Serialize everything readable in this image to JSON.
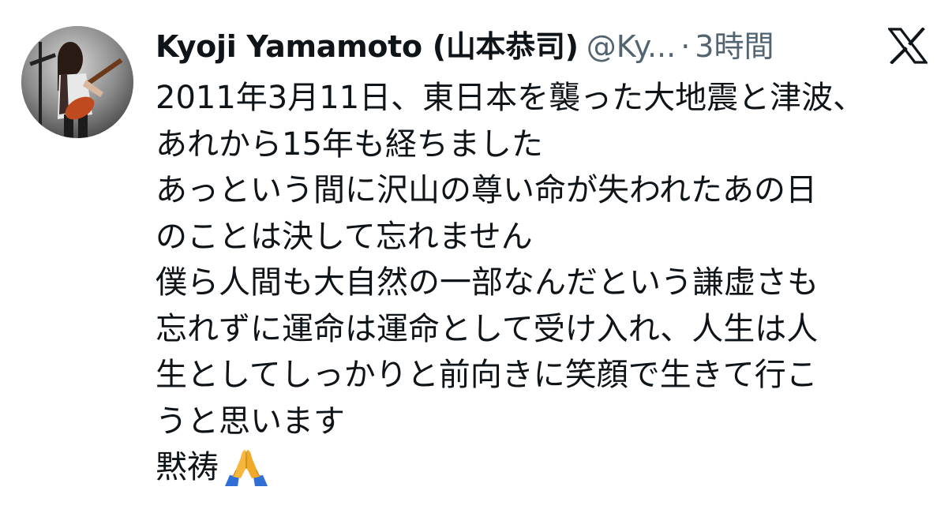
{
  "author": {
    "display_name": "Kyoji Yamamoto (山本恭司)",
    "handle": "@Ky...",
    "separator": "·",
    "time": "3時間",
    "avatar": "avatar-guitarist-photo"
  },
  "platform_icon": "x-logo-icon",
  "tweet": {
    "lines": [
      "2011年3月11日、東日本を襲った大地震と津波、",
      "あれから15年も経ちました",
      "あっという間に沢山の尊い命が失われたあの日",
      "のことは決して忘れません",
      "僕ら人間も大自然の一部なんだという謙虚さも",
      "忘れずに運命は運命として受け入れ、人生は人",
      "生としてしっかりと前向きに笑顔で生きて行こ",
      "うと思います",
      "黙祷"
    ],
    "emoji": "folded-hands-icon"
  },
  "colors": {
    "text": "#0f1419",
    "secondary": "#536471",
    "background": "#ffffff"
  }
}
